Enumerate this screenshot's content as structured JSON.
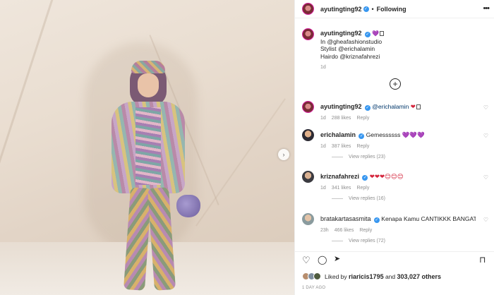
{
  "colors": {
    "accent_blue": "#3897f0",
    "text": "#262626",
    "muted": "#8e8e8e",
    "mention": "#00376b"
  },
  "photo": {
    "next_icon": "chevron-right-icon",
    "next_glyph": "›"
  },
  "header": {
    "username": "ayutingting92",
    "verified_glyph": "✓",
    "separator": "•",
    "follow_label": "Following",
    "more_glyph": "•••"
  },
  "caption": {
    "username": "ayutingting92",
    "heart": "💜",
    "lines": [
      "In @gheafashionstudio",
      "Stylist @erichalamin",
      "Hairdo @kriznafahrezi"
    ],
    "time": "1d"
  },
  "load_more_glyph": "+",
  "comments": [
    {
      "username": "ayutingting92",
      "text": "@erichalamin",
      "extra": "❤",
      "time": "1d",
      "likes": "288 likes",
      "reply": "Reply"
    },
    {
      "username": "erichalamin",
      "text": "Gemessssss",
      "extra": "💜💜💜",
      "time": "1d",
      "likes": "387 likes",
      "reply": "Reply",
      "view_replies": "View replies (23)"
    },
    {
      "username": "kriznafahrezi",
      "text": "",
      "extra": "❤❤❤😊😊😊",
      "time": "1d",
      "likes": "341 likes",
      "reply": "Reply",
      "view_replies": "View replies (16)"
    },
    {
      "username": "bratakartasasmita",
      "text": "Kenapa Kamu CANTIKKK BANGATTT...",
      "extra": "",
      "time": "23h",
      "likes": "466 likes",
      "reply": "Reply",
      "view_replies": "View replies (72)"
    }
  ],
  "actions": {
    "like_icon": "heart-icon",
    "comment_icon": "comment-icon",
    "share_icon": "share-icon",
    "save_icon": "bookmark-icon"
  },
  "likes": {
    "prefix": "Liked by ",
    "user": "riaricis1795",
    "middle": " and ",
    "count": "303,027 others"
  },
  "date": "1 DAY AGO"
}
